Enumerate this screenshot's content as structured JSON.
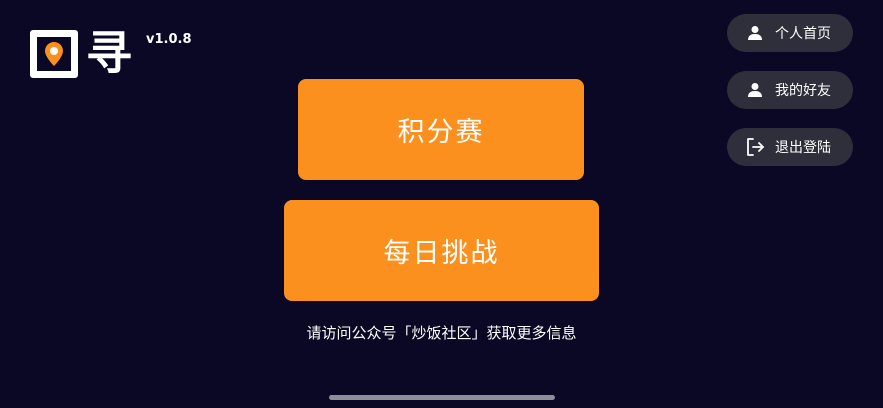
{
  "app": {
    "logo_text": "寻",
    "version": "v1.0.8"
  },
  "main": {
    "points_match_label": "积分赛",
    "daily_challenge_label": "每日挑战",
    "notice": "请访问公众号「炒饭社区」获取更多信息"
  },
  "side_menu": {
    "home_label": "个人首页",
    "friends_label": "我的好友",
    "logout_label": "退出登陆"
  },
  "icons": {
    "logo": "map-pin-icon",
    "home": "user-icon",
    "friends": "user-icon",
    "logout": "logout-icon"
  },
  "colors": {
    "background": "#0b0826",
    "accent": "#fb901e",
    "pill": "#2f2f3b"
  }
}
